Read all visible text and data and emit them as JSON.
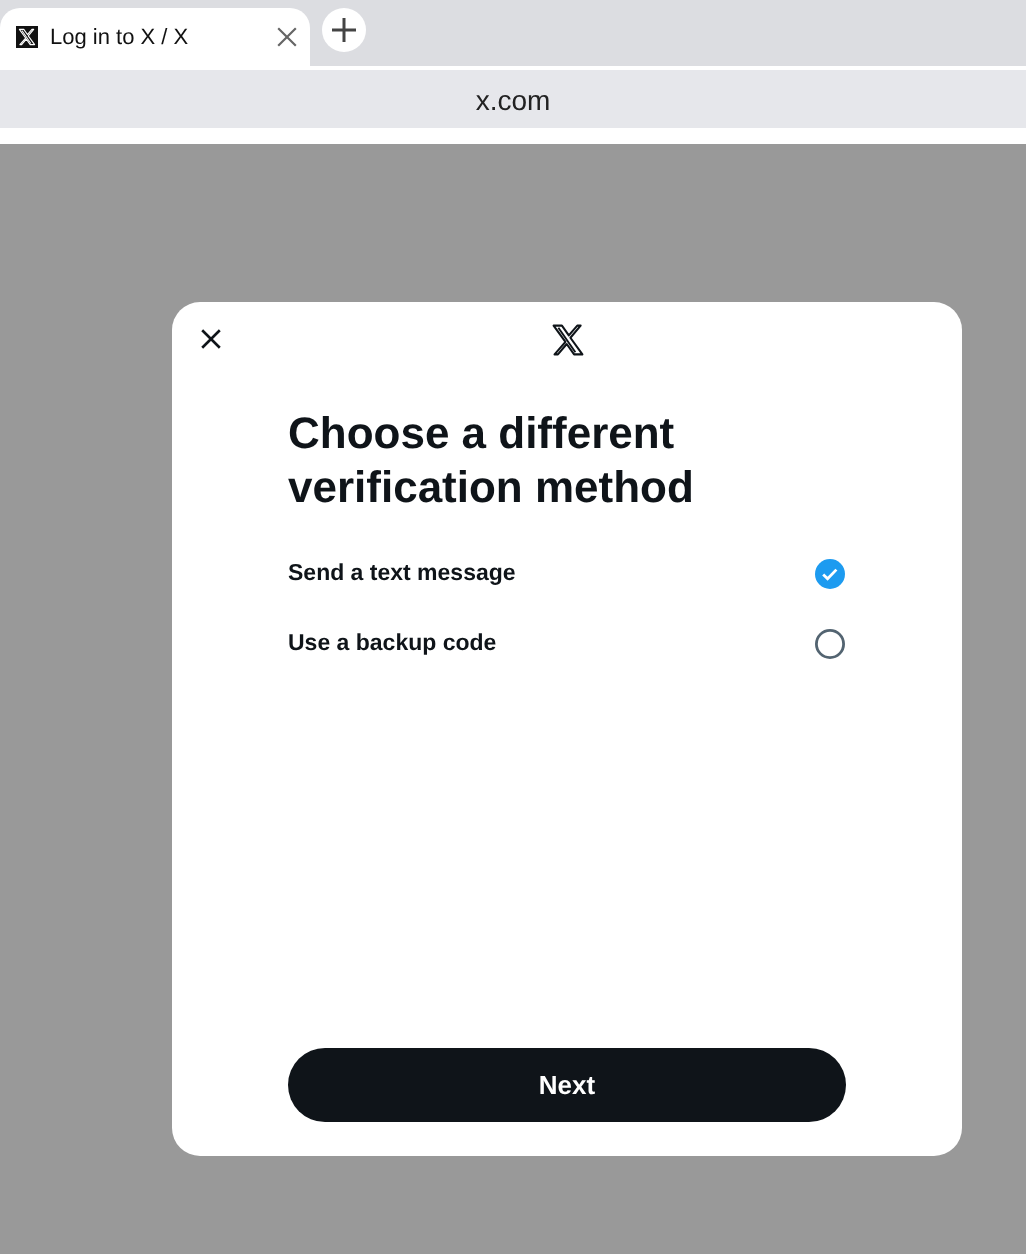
{
  "browser": {
    "tab": {
      "title": "Log in to X / X",
      "selected": true
    },
    "address": "x.com"
  },
  "dialog": {
    "heading": "Choose a different verification method",
    "options": [
      {
        "label": "Send a text message",
        "selected": true
      },
      {
        "label": "Use a backup code",
        "selected": false
      }
    ],
    "button": "Next"
  }
}
